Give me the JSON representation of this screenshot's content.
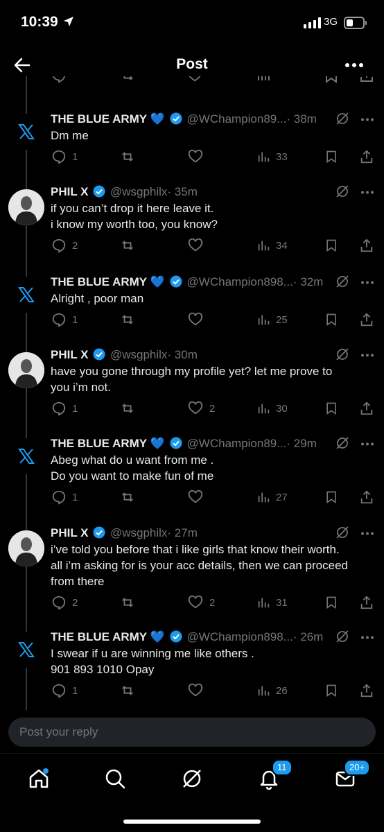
{
  "status_bar": {
    "time": "10:39",
    "network": "3G"
  },
  "header": {
    "title": "Post"
  },
  "tweets": [
    {
      "name": "THE BLUE ARMY",
      "emoji": "💙",
      "handle": "@WChampion89...",
      "time": "· 38m",
      "body": [
        "Dm me"
      ],
      "replies": "1",
      "reposts": "",
      "likes": "",
      "views": "33"
    },
    {
      "name": "PHIL X",
      "emoji": "",
      "handle": "@wsgphilx",
      "time": "· 35m",
      "body": [
        "if you can’t drop it here leave it.",
        "i know my worth too, you know?"
      ],
      "replies": "2",
      "reposts": "",
      "likes": "",
      "views": "34"
    },
    {
      "name": "THE BLUE ARMY",
      "emoji": "💙",
      "handle": "@WChampion898...",
      "time": "· 32m",
      "body": [
        "Alright , poor man"
      ],
      "replies": "1",
      "reposts": "",
      "likes": "",
      "views": "25"
    },
    {
      "name": "PHIL X",
      "emoji": "",
      "handle": "@wsgphilx",
      "time": "· 30m",
      "body": [
        "have you gone through my profile yet? let me prove to",
        "you i’m not."
      ],
      "replies": "1",
      "reposts": "",
      "likes": "2",
      "views": "30"
    },
    {
      "name": "THE BLUE ARMY",
      "emoji": "💙",
      "handle": "@WChampion89...",
      "time": "· 29m",
      "body": [
        "Abeg what do u want from me .",
        "Do you want to make fun of me"
      ],
      "replies": "1",
      "reposts": "",
      "likes": "",
      "views": "27"
    },
    {
      "name": "PHIL X",
      "emoji": "",
      "handle": "@wsgphilx",
      "time": "· 27m",
      "body": [
        "i’ve told you before that i like girls that know their worth.",
        "all i’m asking for is your acc details, then we can proceed",
        "from there"
      ],
      "replies": "2",
      "reposts": "",
      "likes": "2",
      "views": "31"
    },
    {
      "name": "THE BLUE ARMY",
      "emoji": "💙",
      "handle": "@WChampion898...",
      "time": "· 26m",
      "body": [
        "I swear if u are winning me like others .",
        "901 893 1010 Opay"
      ],
      "replies": "1",
      "reposts": "",
      "likes": "",
      "views": "26"
    }
  ],
  "composer": {
    "placeholder": "Post your reply"
  },
  "tabbar": {
    "notifications_badge": "11",
    "messages_badge": "20+"
  },
  "colors": {
    "accent": "#1d9bf0",
    "muted": "#71767b",
    "text": "#e7e9ea",
    "background": "#000000"
  }
}
